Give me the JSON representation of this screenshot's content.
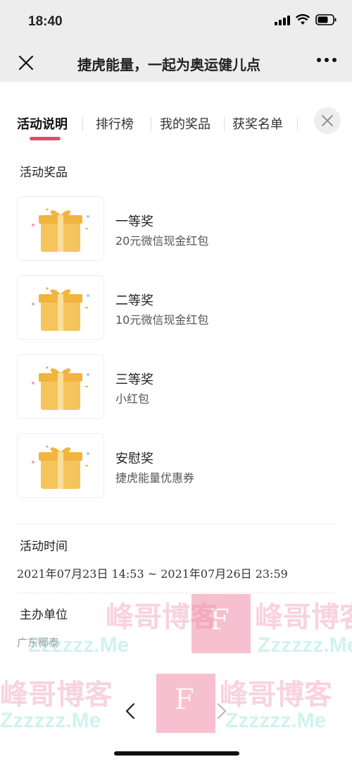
{
  "status": {
    "time": "18:40"
  },
  "navbar": {
    "title": "捷虎能量，一起为奥运健儿点",
    "close_icon": "close-icon",
    "more_icon": "more-dots-icon"
  },
  "tabs": [
    {
      "label": "活动说明"
    },
    {
      "label": "排行榜"
    },
    {
      "label": "我的奖品"
    },
    {
      "label": "获奖名单"
    }
  ],
  "sections": {
    "prizes_title": "活动奖品",
    "time_title": "活动时间",
    "organizer_title": "主办单位"
  },
  "prizes": [
    {
      "name": "一等奖",
      "desc": "20元微信现金红包"
    },
    {
      "name": "二等奖",
      "desc": "10元微信现金红包"
    },
    {
      "name": "三等奖",
      "desc": "小红包"
    },
    {
      "name": "安慰奖",
      "desc": "捷虎能量优惠券"
    }
  ],
  "activity_time": "2021年07月23日 14:53 ~ 2021年07月26日 23:59",
  "organizer": "广东椰泰",
  "watermark": {
    "text": "峰哥博客",
    "sub": "Zzzzzz.Me",
    "letter": "F"
  },
  "colors": {
    "accent": "#e04b6a",
    "tag_bg": "#fde3ea",
    "nav_bg": "#ededed"
  }
}
